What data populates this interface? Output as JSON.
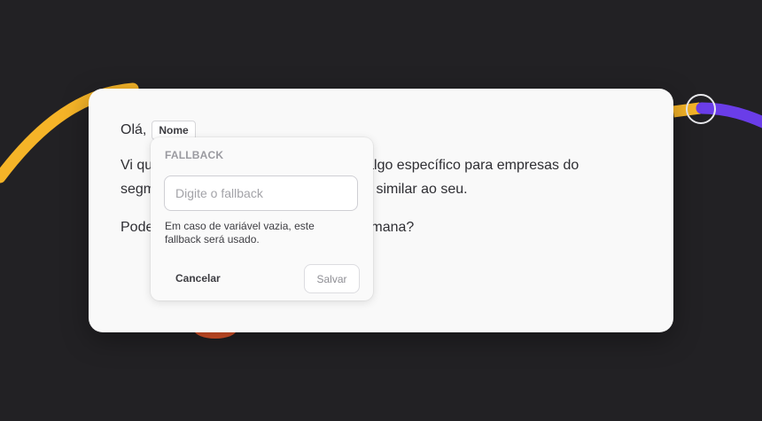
{
  "colors": {
    "background": "#222124",
    "card": "#f9f9f9",
    "accent_yellow": "#f5b428",
    "accent_purple": "#6a3de8",
    "accent_orange": "#e0552a"
  },
  "message": {
    "greeting": "Olá,",
    "variable_chip": "Nome",
    "line2_start": "Vi qu",
    "line2_end": "eparei algo específico para empresas do",
    "line3_start": "segm",
    "line3_end": "o similar ao seu.",
    "line4_start": "Pode",
    "line4_end": "mana?"
  },
  "fallback_popover": {
    "heading": "FALLBACK",
    "input_value": "",
    "input_placeholder": "Digite o fallback",
    "help_text": "Em caso de variável vazia, este fallback será usado.",
    "cancel_label": "Cancelar",
    "save_label": "Salvar"
  }
}
